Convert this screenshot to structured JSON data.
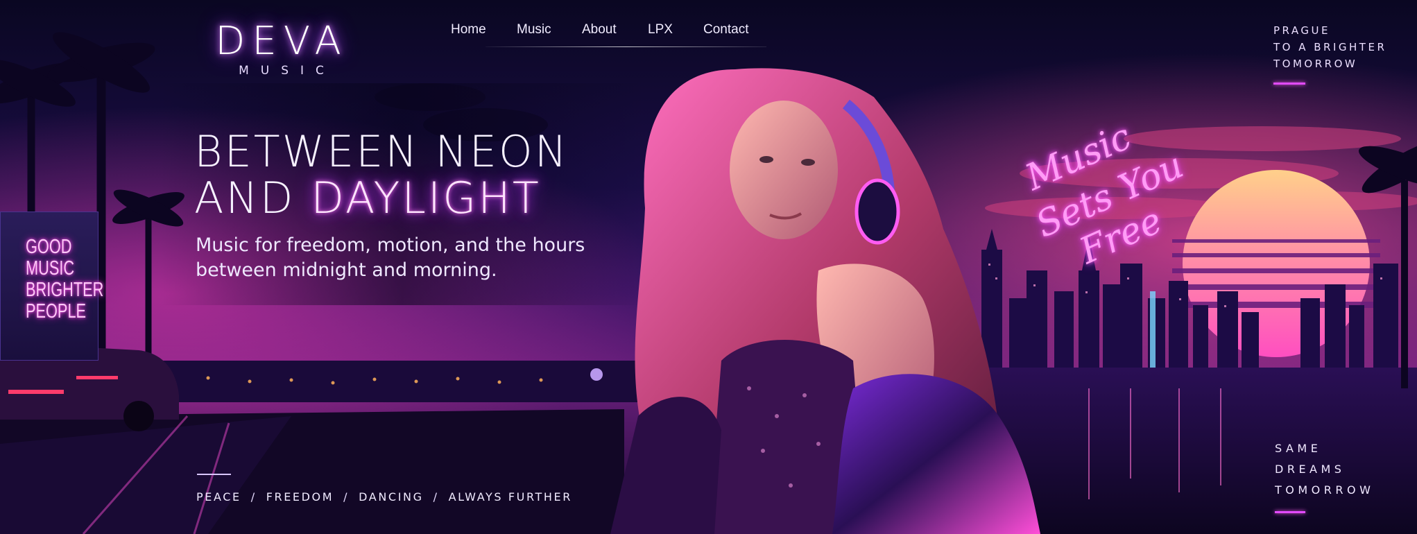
{
  "logo": {
    "word": "DEVA",
    "sub": "MUSIC"
  },
  "nav": {
    "items": [
      "Home",
      "Music",
      "About",
      "LPX",
      "Contact"
    ]
  },
  "top_right": {
    "line1": "PRAGUE",
    "line2": "TO A BRIGHTER",
    "line3": "TOMORROW"
  },
  "hero": {
    "line1": "BETWEEN NEON",
    "line2_plain": "AND",
    "line2_glow": "DAYLIGHT",
    "sub1": "Music for freedom, motion, and the hours",
    "sub2": "between midnight and morning."
  },
  "script_text": {
    "line1": "Music",
    "line2": "Sets You",
    "line3": "Free"
  },
  "tags": {
    "items": [
      "PEACE",
      "FREEDOM",
      "DANCING",
      "ALWAYS FURTHER"
    ],
    "separator": "/"
  },
  "bottom_right": {
    "line1": "SAME",
    "line2": "DREAMS",
    "line3": "TOMORROW"
  },
  "billboard": {
    "lines": [
      "GOOD",
      "MUSIC",
      "BRIGHTER",
      "PEOPLE"
    ]
  },
  "colors": {
    "accent_pink": "#e24bff",
    "neon_magenta": "#ff5cf2",
    "sky_top": "#0a0620",
    "sun": "#ffb36b"
  }
}
